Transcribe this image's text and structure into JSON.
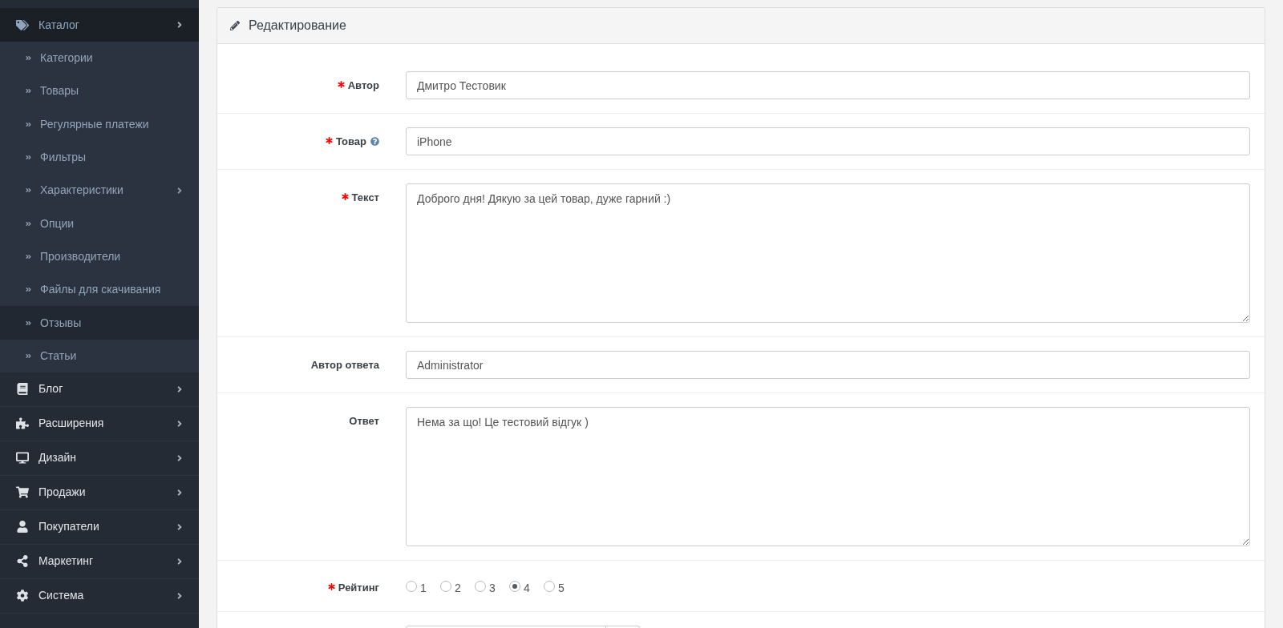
{
  "sidebar": {
    "items": [
      {
        "label": "Каталог",
        "expanded": true,
        "collapsible": true,
        "children": [
          {
            "label": "Категории",
            "selected": false,
            "collapsible": false
          },
          {
            "label": "Товары",
            "selected": false,
            "collapsible": false
          },
          {
            "label": "Регулярные платежи",
            "selected": false,
            "collapsible": false
          },
          {
            "label": "Фильтры",
            "selected": false,
            "collapsible": false
          },
          {
            "label": "Характеристики",
            "selected": false,
            "collapsible": true
          },
          {
            "label": "Опции",
            "selected": false,
            "collapsible": false
          },
          {
            "label": "Производители",
            "selected": false,
            "collapsible": false
          },
          {
            "label": "Файлы для скачивания",
            "selected": false,
            "collapsible": false
          },
          {
            "label": "Отзывы",
            "selected": true,
            "collapsible": false
          },
          {
            "label": "Статьи",
            "selected": false,
            "collapsible": false
          }
        ]
      },
      {
        "label": "Блог",
        "expanded": false,
        "collapsible": true
      },
      {
        "label": "Расширения",
        "expanded": false,
        "collapsible": true
      },
      {
        "label": "Дизайн",
        "expanded": false,
        "collapsible": true
      },
      {
        "label": "Продажи",
        "expanded": false,
        "collapsible": true
      },
      {
        "label": "Покупатели",
        "expanded": false,
        "collapsible": true
      },
      {
        "label": "Маркетинг",
        "expanded": false,
        "collapsible": true
      },
      {
        "label": "Система",
        "expanded": false,
        "collapsible": true
      }
    ]
  },
  "panel": {
    "title": "Редактирование"
  },
  "form": {
    "fields": [
      {
        "kind": "input",
        "label": "Автор",
        "required": true,
        "help": false,
        "value": "Дмитро Тестовик"
      },
      {
        "kind": "input",
        "label": "Товар",
        "required": true,
        "help": true,
        "value": "iPhone"
      },
      {
        "kind": "textarea",
        "label": "Текст",
        "required": true,
        "help": false,
        "value": "Доброго дня! Дякую за цей товар, дуже гарний :)"
      },
      {
        "kind": "input",
        "label": "Автор ответа",
        "required": false,
        "help": false,
        "value": "Administrator"
      },
      {
        "kind": "textarea",
        "label": "Ответ",
        "required": false,
        "help": false,
        "value": "Нема за що! Це тестовий відгук )"
      },
      {
        "kind": "rating",
        "label": "Рейтинг",
        "required": true,
        "help": false,
        "options": [
          {
            "label": "1",
            "selected": false
          },
          {
            "label": "2",
            "selected": false
          },
          {
            "label": "3",
            "selected": false
          },
          {
            "label": "4",
            "selected": true
          },
          {
            "label": "5",
            "selected": false
          }
        ]
      },
      {
        "kind": "date"
      }
    ]
  }
}
